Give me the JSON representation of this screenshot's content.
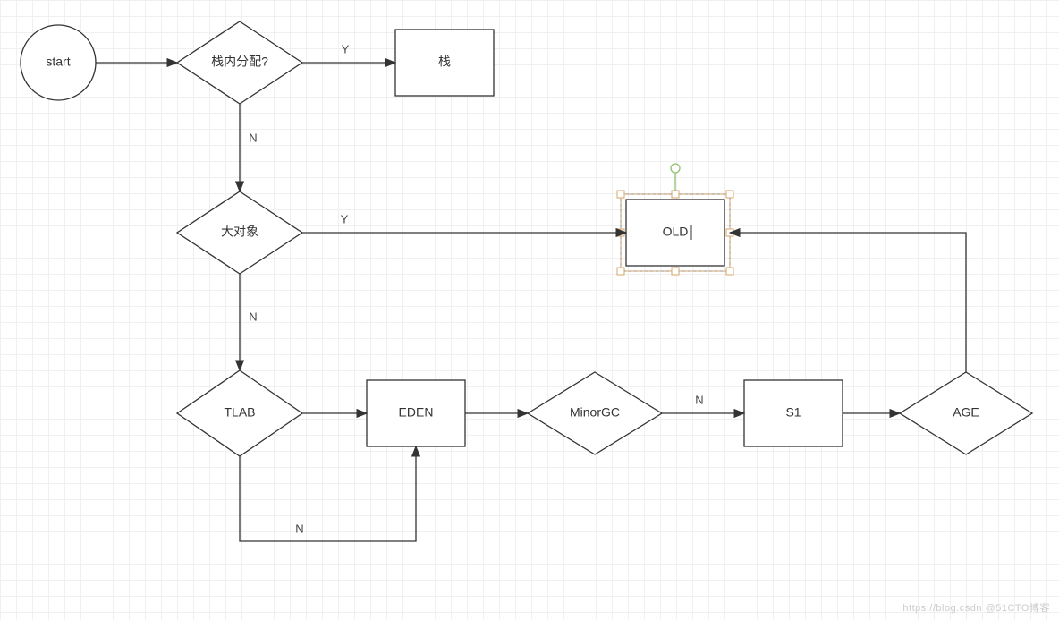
{
  "nodes": {
    "start": {
      "label": "start"
    },
    "stack_alloc": {
      "label": "栈内分配?"
    },
    "stack": {
      "label": "栈"
    },
    "big_obj": {
      "label": "大对象"
    },
    "old": {
      "label": "OLD"
    },
    "tlab": {
      "label": "TLAB"
    },
    "eden": {
      "label": "EDEN"
    },
    "minor_gc": {
      "label": "MinorGC"
    },
    "s1": {
      "label": "S1"
    },
    "age": {
      "label": "AGE"
    }
  },
  "edges": {
    "stack_alloc_y": {
      "label": "Y"
    },
    "stack_alloc_n": {
      "label": "N"
    },
    "big_obj_y": {
      "label": "Y"
    },
    "big_obj_n": {
      "label": "N"
    },
    "tlab_n": {
      "label": "N"
    },
    "minor_gc_n": {
      "label": "N"
    }
  },
  "watermark": "https://blog.csdn @51CTO博客"
}
